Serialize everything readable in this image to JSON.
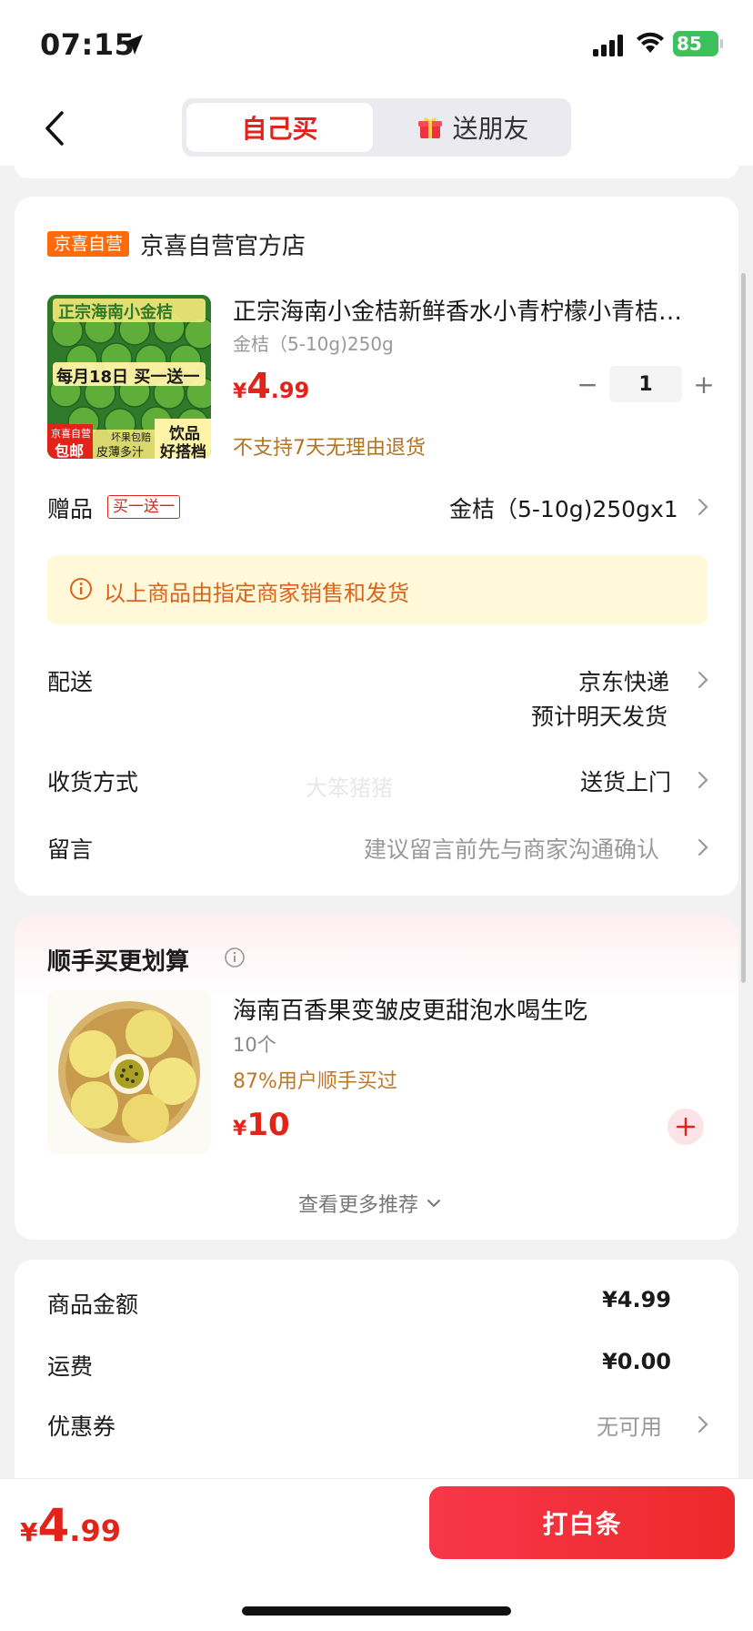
{
  "status_bar": {
    "time": "07:15",
    "battery": "85"
  },
  "nav": {
    "tab_self": "自己买",
    "tab_friend": "送朋友"
  },
  "store": {
    "badge": "京喜自营",
    "name": "京喜自营官方店"
  },
  "product": {
    "title": "正宗海南小金桔新鲜香水小青柠檬小青桔…",
    "spec": "金桔（5-10g)250g",
    "price_symbol": "¥",
    "price_int": "4",
    "price_dec": ".99",
    "quantity": "1",
    "qty_minus": "−",
    "qty_plus": "+",
    "return_policy": "不支持7天无理由退货",
    "image_texts": {
      "top": "正宗海南小金桔",
      "promo": "每月18日 买一送一",
      "corner_badge": "京喜自营",
      "corner_badge2": "包邮",
      "bottom_left": "坏果包赔",
      "bottom_left2": "皮薄多汁",
      "bottom_right": "饮品",
      "bottom_right2": "好搭档"
    }
  },
  "gift": {
    "label": "赠品",
    "tag": "买一送一",
    "value": "金桔（5-10g)250gx1"
  },
  "notice": {
    "text": "以上商品由指定商家销售和发货"
  },
  "shipping": {
    "label": "配送",
    "value": "京东快递",
    "sub": "预计明天发货"
  },
  "receive": {
    "label": "收货方式",
    "value": "送货上门"
  },
  "message": {
    "label": "留言",
    "placeholder": "建议留言前先与商家沟通确认"
  },
  "watermark": "大笨猪猪",
  "recommend": {
    "title": "顺手买更划算",
    "item_name": "海南百香果变皱皮更甜泡水喝生吃",
    "item_qty": "10个",
    "item_bought": "87%用户顺手买过",
    "price_symbol": "¥",
    "price": "10",
    "more": "查看更多推荐"
  },
  "summary": {
    "goods_label": "商品金额",
    "goods_value": "¥4.99",
    "ship_label": "运费",
    "ship_value": "¥0.00",
    "coupon_label": "优惠券",
    "coupon_value": "无可用"
  },
  "bottom": {
    "price_symbol": "¥",
    "price_int": "4",
    "price_dec": ".99",
    "pay_button": "打白条"
  },
  "colors": {
    "accent": "#e2231a",
    "badge_orange": "#ff6a0b",
    "notice_bg": "#fff8d9",
    "notice_text": "#d9641c"
  }
}
